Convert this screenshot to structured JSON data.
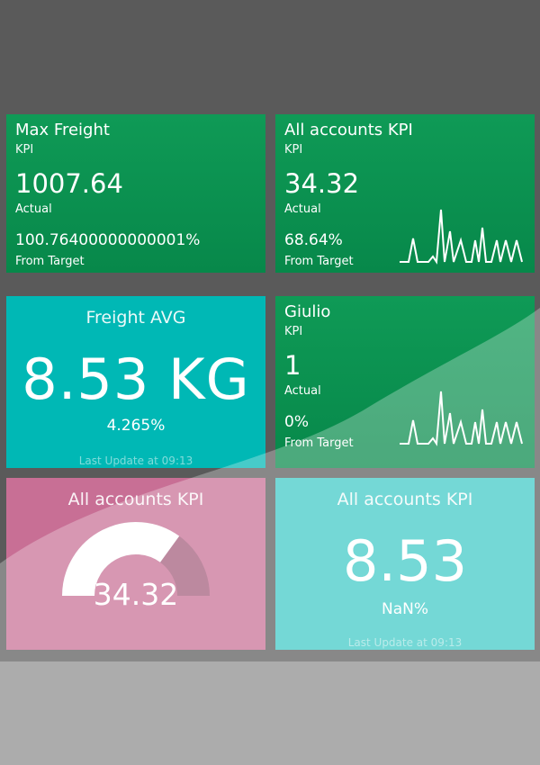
{
  "tiles": {
    "max_freight": {
      "title": "Max Freight",
      "subtitle": "KPI",
      "value": "1007.64",
      "value_label": "Actual",
      "pct": "100.76400000000001%",
      "pct_label": "From Target"
    },
    "all_accounts_1": {
      "title": "All accounts KPI",
      "subtitle": "KPI",
      "value": "34.32",
      "value_label": "Actual",
      "pct": "68.64%",
      "pct_label": "From Target",
      "sparkline": "sparkline"
    },
    "freight_avg": {
      "title": "Freight AVG",
      "value": "8.53 KG",
      "pct": "4.265%",
      "last_update": "Last Update at 09:13"
    },
    "giulio": {
      "title": "Giulio",
      "subtitle": "KPI",
      "value": "1",
      "value_label": "Actual",
      "pct": "0%",
      "pct_label": "From Target",
      "sparkline": "sparkline"
    },
    "all_accounts_gauge": {
      "title": "All accounts KPI",
      "value": "34.32",
      "gauge_fraction": 0.7
    },
    "all_accounts_4": {
      "title": "All accounts KPI",
      "value": "8.53",
      "pct": "NaN%",
      "last_update": "Last Update at 09:13"
    }
  },
  "colors": {
    "green": "#0a9150",
    "teal": "#00b8b5",
    "pink": "#c86f95",
    "teal_light": "#3fc9c6",
    "background": "#5a5a5a"
  }
}
